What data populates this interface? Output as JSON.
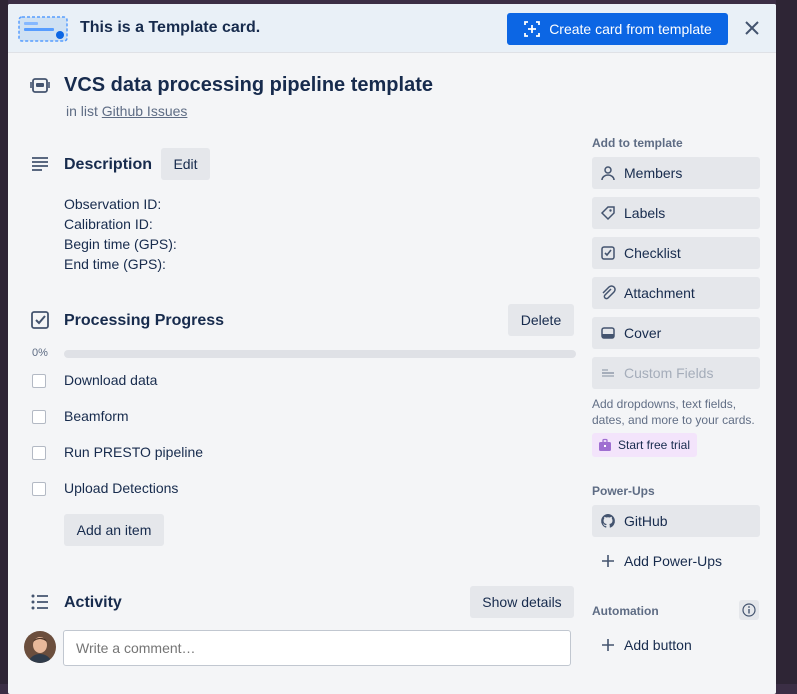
{
  "banner": {
    "text": "This is a Template card.",
    "create_button": "Create card from template"
  },
  "card": {
    "title": "VCS data processing pipeline template",
    "in_list_prefix": "in list",
    "list_name": "Github Issues"
  },
  "description": {
    "heading": "Description",
    "edit_label": "Edit",
    "lines": [
      "Observation ID:",
      "Calibration ID:",
      "Begin time (GPS):",
      "End time (GPS):"
    ]
  },
  "checklist": {
    "heading": "Processing Progress",
    "delete_label": "Delete",
    "percent_text": "0%",
    "progress": 0,
    "items": [
      "Download data",
      "Beamform",
      "Run PRESTO pipeline",
      "Upload Detections"
    ],
    "add_item_label": "Add an item"
  },
  "activity": {
    "heading": "Activity",
    "show_details_label": "Show details",
    "comment_placeholder": "Write a comment…"
  },
  "sidebar": {
    "add_heading": "Add to template",
    "buttons": [
      {
        "label": "Members",
        "icon": "person-icon"
      },
      {
        "label": "Labels",
        "icon": "tag-icon"
      },
      {
        "label": "Checklist",
        "icon": "checkbox-icon"
      },
      {
        "label": "Attachment",
        "icon": "paperclip-icon"
      },
      {
        "label": "Cover",
        "icon": "cover-icon"
      },
      {
        "label": "Custom Fields",
        "icon": "fields-icon"
      }
    ],
    "custom_fields_note": "Add dropdowns, text fields, dates, and more to your cards.",
    "trial_label": "Start free trial",
    "powerups_heading": "Power-Ups",
    "github_label": "GitHub",
    "add_powerups_label": "Add Power-Ups",
    "automation_heading": "Automation",
    "add_button_label": "Add button"
  },
  "colors": {
    "primary": "#0c66e4",
    "panel": "#f4f5f7",
    "button_grey": "#e5e7eb",
    "trial_bg": "#f3e4fb"
  }
}
